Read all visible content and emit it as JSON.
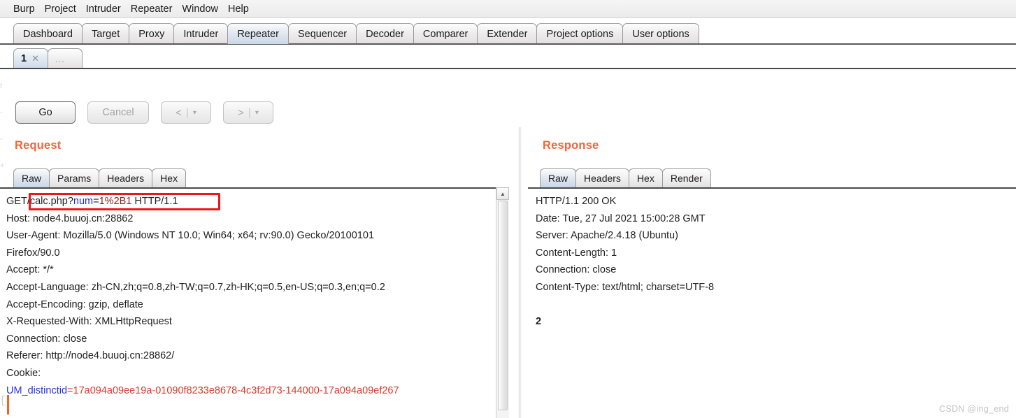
{
  "app": {
    "title": "Burp Suite Repeater",
    "watermark": "CSDN @ing_end"
  },
  "menubar": {
    "items": [
      {
        "label": "Burp"
      },
      {
        "label": "Project"
      },
      {
        "label": "Intruder"
      },
      {
        "label": "Repeater"
      },
      {
        "label": "Window"
      },
      {
        "label": "Help"
      }
    ]
  },
  "main_tabs": {
    "selected": "Repeater",
    "items": [
      {
        "label": "Dashboard",
        "selected": false
      },
      {
        "label": "Target",
        "selected": false
      },
      {
        "label": "Proxy",
        "selected": false
      },
      {
        "label": "Intruder",
        "selected": false
      },
      {
        "label": "Repeater",
        "selected": true
      },
      {
        "label": "Sequencer",
        "selected": false
      },
      {
        "label": "Decoder",
        "selected": false
      },
      {
        "label": "Comparer",
        "selected": false
      },
      {
        "label": "Extender",
        "selected": false
      },
      {
        "label": "Project options",
        "selected": false
      },
      {
        "label": "User options",
        "selected": false
      }
    ]
  },
  "repeater_tabs": {
    "selected": "1",
    "items": [
      {
        "label": "1",
        "close_icon": "close-x-icon",
        "selected": true
      },
      {
        "label": "...",
        "selected": false
      }
    ]
  },
  "toolbar": {
    "go_label": "Go",
    "cancel_label": "Cancel",
    "cancel_enabled": false,
    "back_label": "<",
    "back_caret": "▾",
    "forward_label": ">",
    "forward_caret": "▾",
    "separator": "|"
  },
  "request": {
    "title": "Request",
    "tabs": [
      {
        "label": "Raw",
        "selected": true
      },
      {
        "label": "Params",
        "selected": false
      },
      {
        "label": "Headers",
        "selected": false
      },
      {
        "label": "Hex",
        "selected": false
      }
    ],
    "request_line": {
      "method": "GET",
      "path": "/calc.php?",
      "param_name": "num",
      "equals": "=",
      "param_value": "1%2B1",
      "version": " HTTP/1.1"
    },
    "headers": [
      "Host: node4.buuoj.cn:28862",
      "User-Agent: Mozilla/5.0 (Windows NT 10.0; Win64; x64; rv:90.0) Gecko/20100101",
      "Firefox/90.0",
      "Accept: */*",
      "Accept-Language: zh-CN,zh;q=0.8,zh-TW;q=0.7,zh-HK;q=0.5,en-US;q=0.3,en;q=0.2",
      "Accept-Encoding: gzip, deflate",
      "X-Requested-With: XMLHttpRequest",
      "Connection: close",
      "Referer: http://node4.buuoj.cn:28862/",
      "Cookie:"
    ],
    "cookie": {
      "name": "UM_distinctid",
      "equals": "=",
      "value": "17a094a09ee19a-01090f8233e8678-4c3f2d73-144000-17a094a09ef267"
    },
    "annotation": {
      "shape": "rectangle",
      "color": "#ef1616",
      "covers": "/calc.php?num=1%2B1 HTTP/1.1"
    },
    "scrollbar": {
      "up_arrow": "▲"
    }
  },
  "response": {
    "title": "Response",
    "tabs": [
      {
        "label": "Raw",
        "selected": true
      },
      {
        "label": "Headers",
        "selected": false
      },
      {
        "label": "Hex",
        "selected": false
      },
      {
        "label": "Render",
        "selected": false
      }
    ],
    "status_line": "HTTP/1.1 200 OK",
    "headers": [
      "Date: Tue, 27 Jul 2021 15:00:28 GMT",
      "Server: Apache/2.4.18 (Ubuntu)",
      "Content-Length: 1",
      "Connection: close",
      "Content-Type: text/html; charset=UTF-8"
    ],
    "body": "2"
  },
  "colors": {
    "accent": "#f2653a",
    "annotation": "#ef1616",
    "param_name": "#1c2ce0",
    "param_value": "#8e1f1f",
    "cookie_name": "#2b33d6",
    "cookie_value": "#d63a2b",
    "caret": "#f4611f"
  }
}
